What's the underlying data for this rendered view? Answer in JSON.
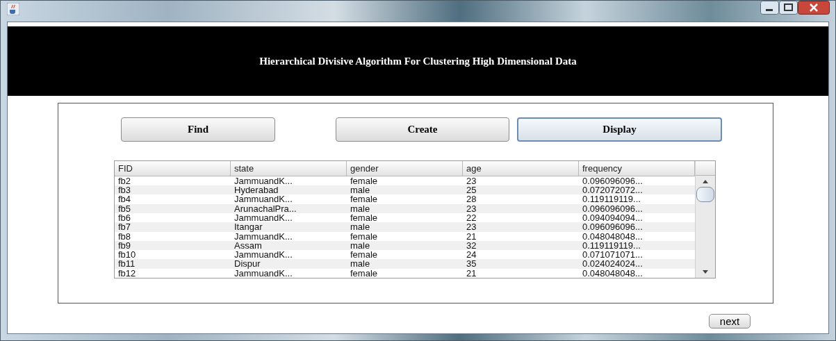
{
  "header": {
    "title": "Hierarchical Divisive Algorithm For Clustering High Dimensional Data"
  },
  "buttons": [
    {
      "label": "Find",
      "focused": false
    },
    {
      "label": "Create",
      "focused": false
    },
    {
      "label": "Display",
      "focused": true
    }
  ],
  "table": {
    "columns": [
      "FID",
      "state",
      "gender",
      "age",
      "frequency"
    ],
    "rows": [
      [
        "fb2",
        "JammuandK...",
        "female",
        "23",
        "0.096096096..."
      ],
      [
        "fb3",
        "Hyderabad",
        "male",
        "25",
        "0.072072072..."
      ],
      [
        "fb4",
        "JammuandK...",
        "female",
        "28",
        "0.119119119..."
      ],
      [
        "fb5",
        "ArunachalPra...",
        "male",
        "23",
        "0.096096096..."
      ],
      [
        "fb6",
        "JammuandK...",
        "female",
        "22",
        "0.094094094..."
      ],
      [
        "fb7",
        "Itangar",
        "male",
        "23",
        "0.096096096..."
      ],
      [
        "fb8",
        "JammuandK...",
        "female",
        "21",
        "0.048048048..."
      ],
      [
        "fb9",
        "Assam",
        "male",
        "32",
        "0.119119119..."
      ],
      [
        "fb10",
        "JammuandK...",
        "female",
        "24",
        "0.071071071..."
      ],
      [
        "fb11",
        "Dispur",
        "male",
        "35",
        "0.024024024..."
      ],
      [
        "fb12",
        "JammuandK...",
        "female",
        "21",
        "0.048048048..."
      ]
    ]
  },
  "next_button": {
    "label": "next"
  }
}
